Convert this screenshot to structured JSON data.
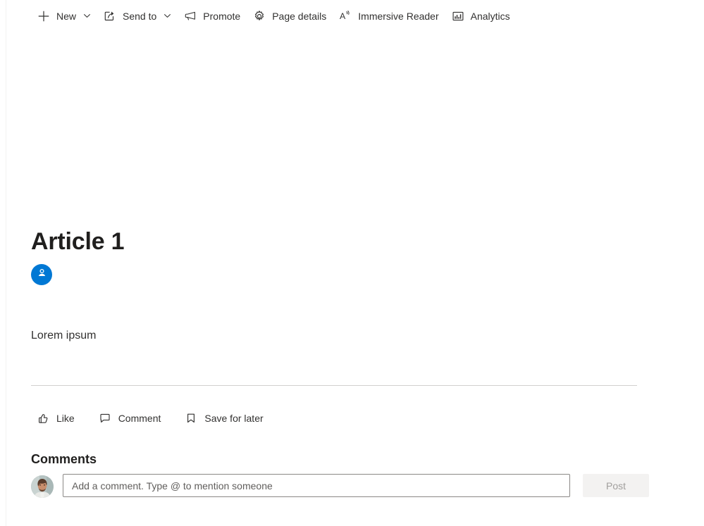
{
  "command_bar": {
    "items": [
      {
        "label": "New",
        "icon": "plus-icon",
        "has_chevron": true
      },
      {
        "label": "Send to",
        "icon": "send-to-icon",
        "has_chevron": true
      },
      {
        "label": "Promote",
        "icon": "megaphone-icon",
        "has_chevron": false
      },
      {
        "label": "Page details",
        "icon": "gear-icon",
        "has_chevron": false
      },
      {
        "label": "Immersive Reader",
        "icon": "immersive-reader-icon",
        "has_chevron": false
      },
      {
        "label": "Analytics",
        "icon": "analytics-icon",
        "has_chevron": false
      }
    ]
  },
  "page": {
    "title": "Article 1",
    "body_text": "Lorem ipsum",
    "author_avatar_icon": "person-icon",
    "author_avatar_color": "#0078d4"
  },
  "social_bar": {
    "items": [
      {
        "label": "Like",
        "icon": "thumbs-up-icon"
      },
      {
        "label": "Comment",
        "icon": "speech-bubble-icon"
      },
      {
        "label": "Save for later",
        "icon": "bookmark-icon"
      }
    ]
  },
  "comments": {
    "heading": "Comments",
    "composer": {
      "avatar_icon": "user-photo-avatar",
      "input_value": "",
      "input_placeholder": "Add a comment. Type @ to mention someone",
      "post_label": "Post"
    }
  },
  "colors": {
    "accent": "#0078d4",
    "text": "#323130",
    "heading": "#201f1e",
    "divider": "#d2d0ce",
    "disabled_bg": "#f3f2f1",
    "disabled_text": "#a19f9d"
  }
}
